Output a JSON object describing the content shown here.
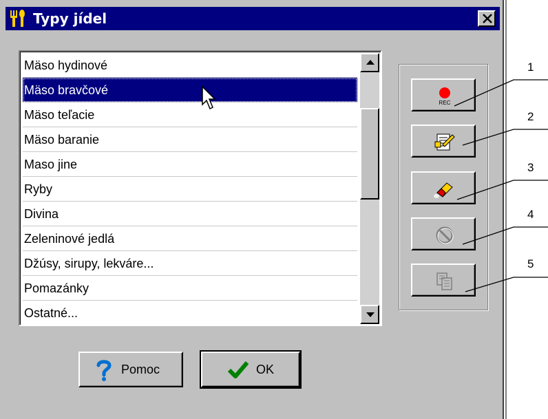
{
  "window": {
    "title": "Typy jídel",
    "close_label": "×"
  },
  "list": {
    "items": [
      {
        "label": "Mäso hydinové",
        "selected": false
      },
      {
        "label": "Mäso bravčové",
        "selected": true
      },
      {
        "label": "Mäso teľacie",
        "selected": false
      },
      {
        "label": "Mäso baranie",
        "selected": false
      },
      {
        "label": "Maso jine",
        "selected": false
      },
      {
        "label": "Ryby",
        "selected": false
      },
      {
        "label": "Divina",
        "selected": false
      },
      {
        "label": "Zeleninové jedlá",
        "selected": false
      },
      {
        "label": "Džúsy, sirupy, lekváre...",
        "selected": false
      },
      {
        "label": "Pomazánky",
        "selected": false
      },
      {
        "label": "Ostatné...",
        "selected": false
      }
    ]
  },
  "toolbar": {
    "buttons": [
      {
        "icon": "record-icon",
        "label": "REC",
        "enabled": true
      },
      {
        "icon": "edit-document-icon",
        "enabled": true
      },
      {
        "icon": "eraser-icon",
        "enabled": true
      },
      {
        "icon": "cancel-icon",
        "enabled": false
      },
      {
        "icon": "copy-icon",
        "enabled": false
      }
    ]
  },
  "actions": {
    "help_label": "Pomoc",
    "ok_label": "OK"
  },
  "callouts": [
    "1",
    "2",
    "3",
    "4",
    "5"
  ],
  "colors": {
    "title_bar": "#000080",
    "selection": "#000080",
    "window_face": "#c0c0c0"
  }
}
